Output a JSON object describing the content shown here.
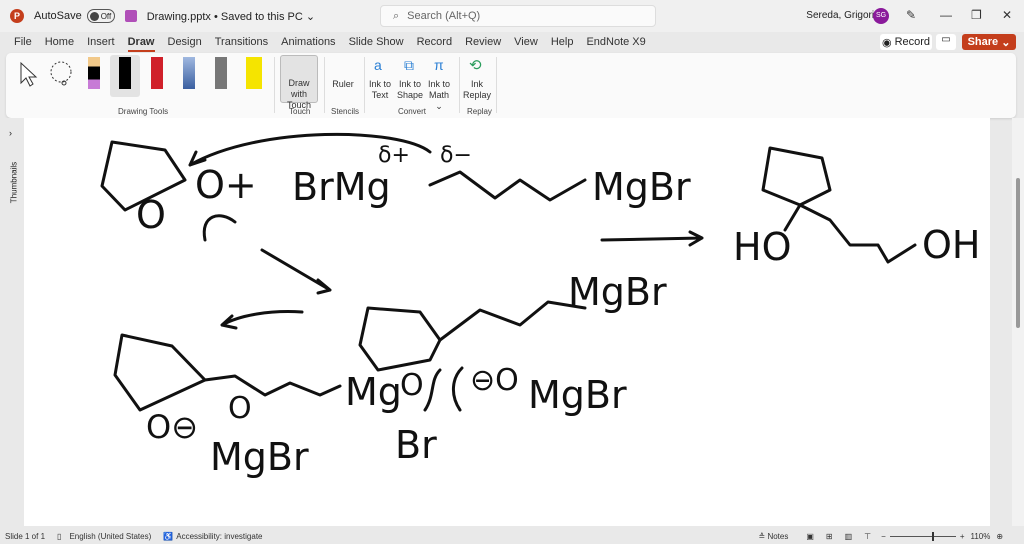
{
  "titlebar": {
    "autosave_label": "AutoSave",
    "autosave_state": "Off",
    "filename": "Drawing.pptx • Saved to this PC ⌄",
    "search_placeholder": "Search (Alt+Q)",
    "user_name": "Sereda, Grigoriy A",
    "user_initials": "SG",
    "minimize": "—",
    "restore": "❐",
    "close": "✕"
  },
  "tabs": [
    "File",
    "Home",
    "Insert",
    "Draw",
    "Design",
    "Transitions",
    "Animations",
    "Slide Show",
    "Record",
    "Review",
    "View",
    "Help",
    "EndNote X9"
  ],
  "active_tab": "Draw",
  "actions": {
    "record": "Record",
    "share": "Share"
  },
  "ribbon": {
    "groups": {
      "drawing_tools": "Drawing Tools",
      "touch": "Touch",
      "stencils": "Stencils",
      "convert": "Convert",
      "replay": "Replay"
    },
    "buttons": {
      "draw_with_touch": "Draw with Touch",
      "ruler": "Ruler",
      "ink_to_text": "Ink to Text",
      "ink_to_shape": "Ink to Shape",
      "ink_to_math": "Ink to Math ⌄",
      "ink_replay": "Ink Replay"
    },
    "pen_colors": [
      "#f2c98a",
      "#000000",
      "#d0202a",
      "#3a5fa0",
      "#777777",
      "#f5e400"
    ]
  },
  "thumbnails_label": "Thumbnails",
  "ink": {
    "o1": "O",
    "o2": "O+",
    "brmg": "BrMg",
    "delta_plus": "δ+",
    "delta_minus": "δ−",
    "mgbr1": "MgBr",
    "ho": "HO",
    "oh": "OH",
    "mgbr2": "MgBr",
    "o3": "O",
    "o4": "⊖O",
    "mgbr3": "MgBr",
    "mg4": "Mg",
    "br4": "Br",
    "o5": "O⊖",
    "o6": "O",
    "mgbr5": "MgBr"
  },
  "status": {
    "slide": "Slide 1 of 1",
    "language": "English (United States)",
    "accessibility": "Accessibility: investigate",
    "notes": "Notes",
    "zoom": "110%"
  }
}
